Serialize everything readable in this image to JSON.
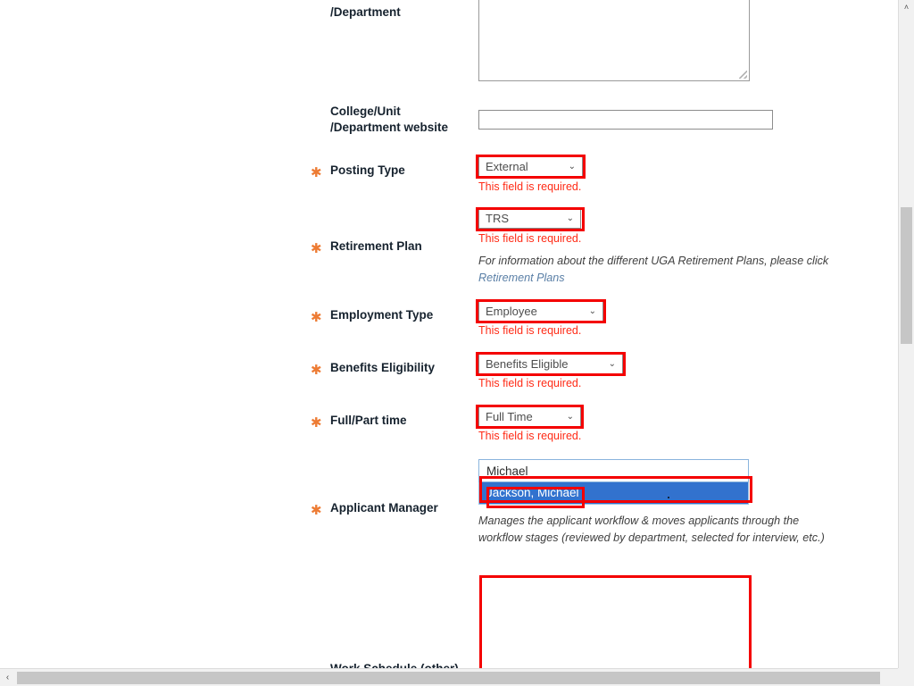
{
  "page": {
    "context": "UGA job posting details form",
    "scroll": {
      "vertical_arrow_up": "˄",
      "horizontal_arrow_left": "‹",
      "horizontal_arrow_right": "›"
    }
  },
  "fields": [
    {
      "id": "department",
      "label": "/Department",
      "required": false,
      "control": "textarea",
      "value": ""
    },
    {
      "id": "college_unit_department_website",
      "label_line1": "College/Unit",
      "label_line2": "/Department website",
      "required": false,
      "control": "text",
      "value": ""
    },
    {
      "id": "posting_type",
      "label": "Posting Type",
      "required": true,
      "required_marker": "★",
      "control": "select",
      "value": "External",
      "error": "This field is required."
    },
    {
      "id": "retirement_plan",
      "label": "Retirement Plan",
      "required": true,
      "control": "select",
      "value": "TRS",
      "error": "This field is required.",
      "helper_prefix": "For information about the different UGA Retirement Plans, please click ",
      "helper_link": "Retirement Plans"
    },
    {
      "id": "employment_type",
      "label": "Employment Type",
      "required": true,
      "control": "select",
      "value": "Employee",
      "error": "This field is required."
    },
    {
      "id": "benefits_eligibility",
      "label": "Benefits Eligibility",
      "required": true,
      "control": "select",
      "value": "Benefits Eligible",
      "error": "This field is required."
    },
    {
      "id": "full_part_time",
      "label": "Full/Part time",
      "required": true,
      "control": "select",
      "value": "Full Time",
      "error": "This field is required."
    },
    {
      "id": "applicant_manager",
      "label": "Applicant Manager",
      "required": true,
      "control": "autocomplete",
      "value": "Michael",
      "suggestion": "Jackson, Michael",
      "helper": "Manages the applicant workflow & moves applicants through the workflow stages (reviewed by department, selected for interview, etc.)"
    },
    {
      "id": "work_schedule_other",
      "label": "Work Schedule (other)",
      "required": false,
      "control": "textarea",
      "value": ""
    }
  ],
  "select_arrow": "⌄",
  "colors": {
    "required_star": "#ed7b33",
    "error_text": "#ff2b16",
    "annotation": "#f40000",
    "highlight": "#3272ce",
    "link": "#5a7fa6",
    "label": "#16222e"
  }
}
